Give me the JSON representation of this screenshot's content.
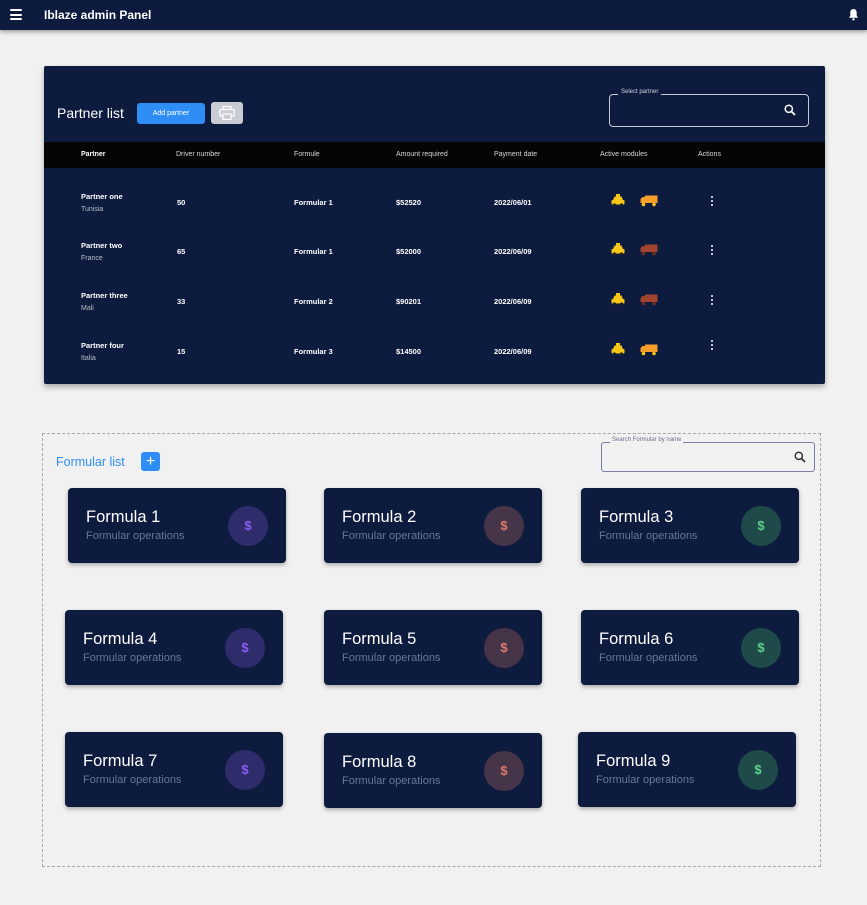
{
  "app": {
    "title": "Iblaze admin Panel"
  },
  "partner_panel": {
    "title": "Partner list",
    "add_button": "Add partner",
    "select_label": "Select partner",
    "columns": [
      "Partner",
      "Driver number",
      "Formule",
      "Amount required",
      "Payment date",
      "Active modules",
      "Actions"
    ],
    "rows": [
      {
        "name": "Partner one",
        "country": "Tunisia",
        "drivers": "50",
        "formula": "Formular 1",
        "amount": "$52520",
        "date": "2022/06/01",
        "modules": [
          "taxi-active",
          "truck-active"
        ]
      },
      {
        "name": "Partner two",
        "country": "France",
        "drivers": "65",
        "formula": "Formular 1",
        "amount": "$52000",
        "date": "2022/06/09",
        "modules": [
          "taxi-active",
          "truck-inactive"
        ]
      },
      {
        "name": "Partner three",
        "country": "Mali",
        "drivers": "33",
        "formula": "Formular 2",
        "amount": "$90201",
        "date": "2022/06/09",
        "modules": [
          "taxi-active",
          "truck-inactive"
        ]
      },
      {
        "name": "Partner four",
        "country": "Italia",
        "drivers": "15",
        "formula": "Formular 3",
        "amount": "$14500",
        "date": "2022/06/09",
        "modules": [
          "taxi-active",
          "truck-active"
        ]
      }
    ]
  },
  "formular_section": {
    "title": "Formular list",
    "search_label": "Search Formular by name",
    "cards": [
      {
        "title": "Formula 1",
        "subtitle": "Formular operations",
        "symbol": "$",
        "accent": "#8b5cf6",
        "bg": "#2e2c6b"
      },
      {
        "title": "Formula 2",
        "subtitle": "Formular operations",
        "symbol": "$",
        "accent": "#e07a6a",
        "bg": "#463548"
      },
      {
        "title": "Formula 3",
        "subtitle": "Formular operations",
        "symbol": "$",
        "accent": "#5fd08a",
        "bg": "#1e4a4a"
      },
      {
        "title": "Formula 4",
        "subtitle": "Formular operations",
        "symbol": "$",
        "accent": "#8b5cf6",
        "bg": "#2e2c6b"
      },
      {
        "title": "Formula 5",
        "subtitle": "Formular operations",
        "symbol": "$",
        "accent": "#e07a6a",
        "bg": "#463548"
      },
      {
        "title": "Formula 6",
        "subtitle": "Formular operations",
        "symbol": "$",
        "accent": "#5fd08a",
        "bg": "#1e4a4a"
      },
      {
        "title": "Formula 7",
        "subtitle": "Formular operations",
        "symbol": "$",
        "accent": "#8b5cf6",
        "bg": "#2e2c6b"
      },
      {
        "title": "Formula 8",
        "subtitle": "Formular operations",
        "symbol": "$",
        "accent": "#e07a6a",
        "bg": "#463548"
      },
      {
        "title": "Formula 9",
        "subtitle": "Formular operations",
        "symbol": "$",
        "accent": "#5fd08a",
        "bg": "#1e4a4a"
      }
    ]
  },
  "colors": {
    "navy": "#0d1b3e",
    "accent_blue": "#2f8ef5",
    "taxi_yellow": "#f5c518",
    "truck_orange": "#f59e2a",
    "truck_inactive": "#a0442f"
  }
}
